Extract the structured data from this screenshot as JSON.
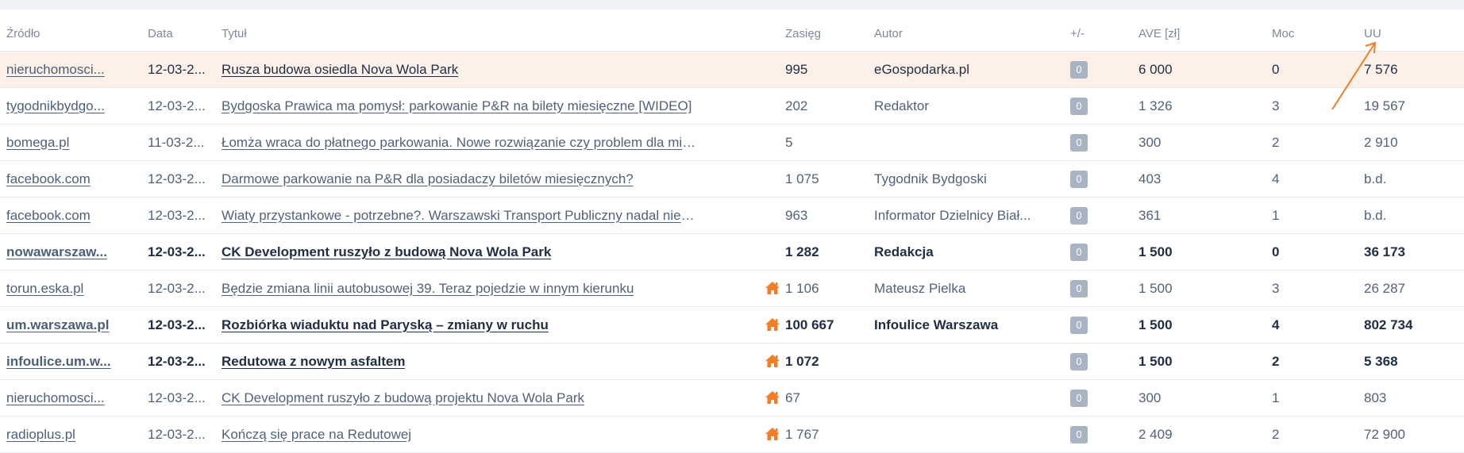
{
  "table": {
    "headers": {
      "source": "Źródło",
      "date": "Data",
      "title": "Tytuł",
      "reach": "Zasięg",
      "author": "Autor",
      "plusminus": "+/-",
      "ave": "AVE [zł]",
      "power": "Moc",
      "uu": "UU"
    },
    "rows": [
      {
        "source": "nieruchomosci...",
        "date": "12-03-2...",
        "title": "Rusza budowa osiedla Nova Wola Park",
        "reach": "995",
        "author": "eGospodarka.pl",
        "pm": "0",
        "ave": "6 000",
        "power": "0",
        "uu": "7 576",
        "home": false,
        "bold": false,
        "highlight": true
      },
      {
        "source": "tygodnikbydgo...",
        "date": "12-03-2...",
        "title": "Bydgoska Prawica ma pomysł: parkowanie P&R na bilety miesięczne [WIDEO]",
        "reach": "202",
        "author": "Redaktor",
        "pm": "0",
        "ave": "1 326",
        "power": "3",
        "uu": "19 567",
        "home": false,
        "bold": false,
        "highlight": false
      },
      {
        "source": "bomega.pl",
        "date": "11-03-2...",
        "title": "Łomża wraca do płatnego parkowania. Nowe rozwiązanie czy problem dla mies...",
        "reach": "5",
        "author": "",
        "pm": "0",
        "ave": "300",
        "power": "2",
        "uu": "2 910",
        "home": false,
        "bold": false,
        "highlight": false
      },
      {
        "source": "facebook.com",
        "date": "12-03-2...",
        "title": "Darmowe parkowanie na P&R dla posiadaczy biletów miesięcznych?",
        "reach": "1 075",
        "author": "Tygodnik Bydgoski",
        "pm": "0",
        "ave": "403",
        "power": "4",
        "uu": "b.d.",
        "home": false,
        "bold": false,
        "highlight": false
      },
      {
        "source": "facebook.com",
        "date": "12-03-2...",
        "title": "Wiaty przystankowe - potrzebne?. Warszawski Transport Publiczny nadal nie u...",
        "reach": "963",
        "author": "Informator Dzielnicy Biał...",
        "pm": "0",
        "ave": "361",
        "power": "1",
        "uu": "b.d.",
        "home": false,
        "bold": false,
        "highlight": false
      },
      {
        "source": "nowawarszaw...",
        "date": "12-03-2...",
        "title": "CK Development ruszyło z budową Nova Wola Park",
        "reach": "1 282",
        "author": "Redakcja",
        "pm": "0",
        "ave": "1 500",
        "power": "0",
        "uu": "36 173",
        "home": false,
        "bold": true,
        "highlight": false
      },
      {
        "source": "torun.eska.pl",
        "date": "12-03-2...",
        "title": "Będzie zmiana linii autobusowej 39. Teraz pojedzie w innym kierunku",
        "reach": "1 106",
        "author": "Mateusz Pielka",
        "pm": "0",
        "ave": "1 500",
        "power": "3",
        "uu": "26 287",
        "home": true,
        "bold": false,
        "highlight": false
      },
      {
        "source": "um.warszawa.pl",
        "date": "12-03-2...",
        "title": "Rozbiórka wiaduktu nad Paryską – zmiany w ruchu",
        "reach": "100 667",
        "author": "Infoulice Warszawa",
        "pm": "0",
        "ave": "1 500",
        "power": "4",
        "uu": "802 734",
        "home": true,
        "bold": true,
        "highlight": false
      },
      {
        "source": "infoulice.um.w...",
        "date": "12-03-2...",
        "title": "Redutowa z nowym asfaltem",
        "reach": "1 072",
        "author": "",
        "pm": "0",
        "ave": "1 500",
        "power": "2",
        "uu": "5 368",
        "home": true,
        "bold": true,
        "highlight": false
      },
      {
        "source": "nieruchomosci...",
        "date": "12-03-2...",
        "title": "CK Development ruszyło z budową projektu Nova Wola Park",
        "reach": "67",
        "author": "",
        "pm": "0",
        "ave": "300",
        "power": "1",
        "uu": "803",
        "home": true,
        "bold": false,
        "highlight": false
      },
      {
        "source": "radioplus.pl",
        "date": "12-03-2...",
        "title": "Kończą się prace na Redutowej",
        "reach": "1 767",
        "author": "",
        "pm": "0",
        "ave": "2 409",
        "power": "2",
        "uu": "72 900",
        "home": true,
        "bold": false,
        "highlight": false
      }
    ]
  },
  "colors": {
    "accent": "#f07e26",
    "highlight_row": "#fdf0e8",
    "badge": "#a9b4c2"
  },
  "icons": {
    "home": "home-icon",
    "annotation": "arrow-annotation"
  }
}
